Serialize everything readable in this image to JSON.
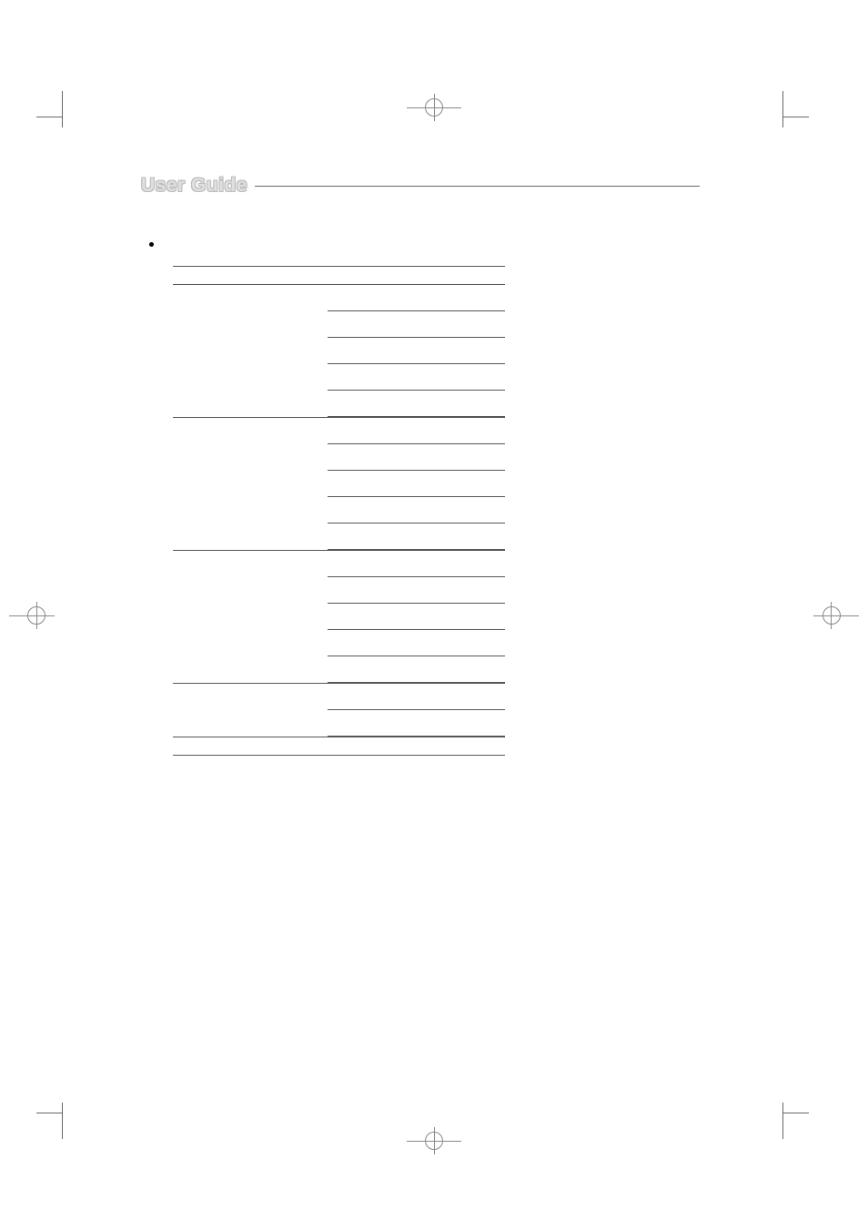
{
  "header": {
    "title": "User Guide"
  },
  "table": {
    "groups": [
      {
        "right_lines": 1,
        "full_top": true
      },
      {
        "right_lines": 5,
        "full_top": true
      },
      {
        "right_lines": 5,
        "full_top": true
      },
      {
        "right_lines": 5,
        "full_top": true
      },
      {
        "right_lines": 2,
        "full_top": true
      },
      {
        "right_lines": 0,
        "full_top": true,
        "trailing_full": true
      }
    ]
  }
}
